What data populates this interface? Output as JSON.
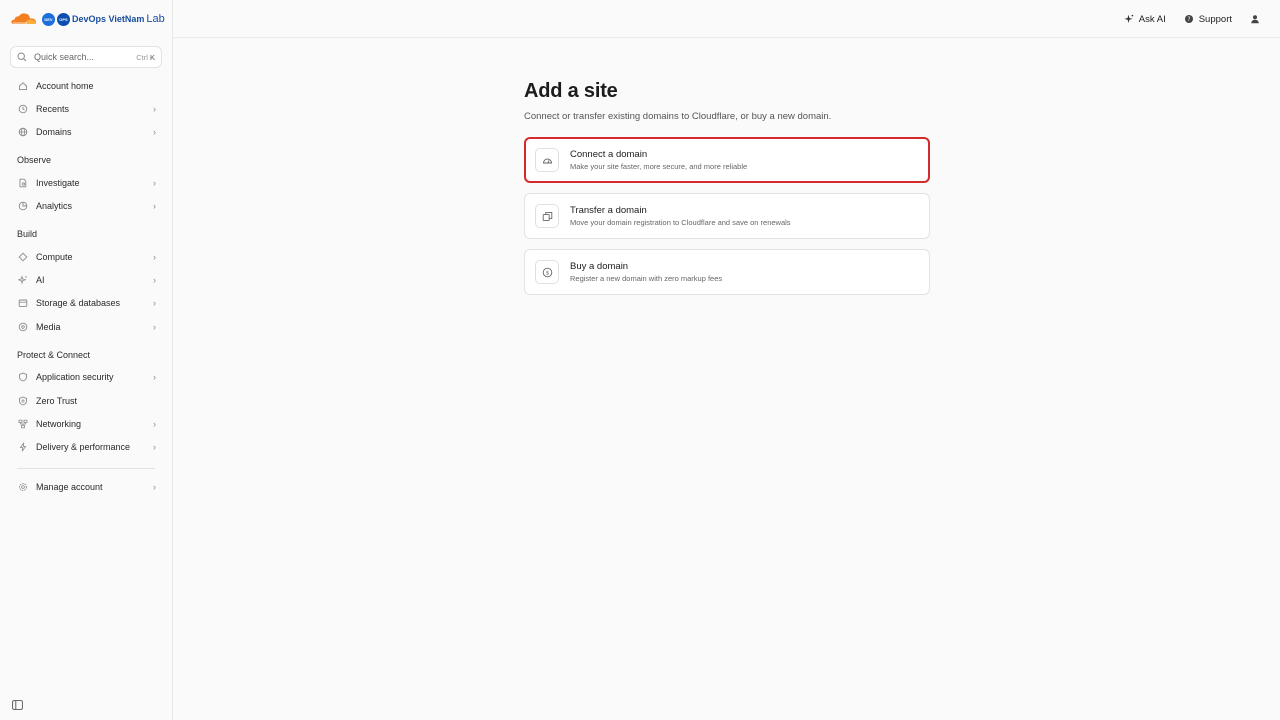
{
  "brand": {
    "badge1": "DEV",
    "badge2": "OPS",
    "name": "DevOps VietNam",
    "suffix": "Lab"
  },
  "search": {
    "placeholder": "Quick search...",
    "shortcut_mod": "Ctrl",
    "shortcut_key": "K"
  },
  "sidebar": {
    "top_items": [
      {
        "label": "Account home",
        "icon": "home-icon"
      },
      {
        "label": "Recents",
        "icon": "clock-icon",
        "chevron": "›"
      },
      {
        "label": "Domains",
        "icon": "globe-icon",
        "chevron": "›"
      }
    ],
    "sections": [
      {
        "label": "Observe",
        "items": [
          {
            "label": "Investigate",
            "icon": "document-search-icon",
            "chevron": "›"
          },
          {
            "label": "Analytics",
            "icon": "pie-chart-icon",
            "chevron": "›"
          }
        ]
      },
      {
        "label": "Build",
        "items": [
          {
            "label": "Compute",
            "icon": "compute-icon",
            "chevron": "›"
          },
          {
            "label": "AI",
            "icon": "sparkle-icon",
            "chevron": "›"
          },
          {
            "label": "Storage & databases",
            "icon": "database-icon",
            "chevron": "›"
          },
          {
            "label": "Media",
            "icon": "media-icon",
            "chevron": "›"
          }
        ]
      },
      {
        "label": "Protect & Connect",
        "items": [
          {
            "label": "Application security",
            "icon": "shield-icon",
            "chevron": "›"
          },
          {
            "label": "Zero Trust",
            "icon": "zero-trust-shield-icon"
          },
          {
            "label": "Networking",
            "icon": "network-icon",
            "chevron": "›"
          },
          {
            "label": "Delivery & performance",
            "icon": "bolt-icon",
            "chevron": "›"
          }
        ]
      }
    ],
    "bottom_items": [
      {
        "label": "Manage account",
        "icon": "gear-icon",
        "chevron": "›"
      }
    ]
  },
  "topbar": {
    "ask_ai": "Ask AI",
    "support": "Support"
  },
  "main": {
    "title": "Add a site",
    "subtitle": "Connect or transfer existing domains to Cloudflare, or buy a new domain.",
    "cards": [
      {
        "title": "Connect a domain",
        "desc": "Make your site faster, more secure, and more reliable",
        "icon": "speedometer-icon",
        "selected": true
      },
      {
        "title": "Transfer a domain",
        "desc": "Move your domain registration to Cloudflare and save on renewals",
        "icon": "transfer-icon",
        "selected": false
      },
      {
        "title": "Buy a domain",
        "desc": "Register a new domain with zero markup fees",
        "icon": "dollar-icon",
        "selected": false
      }
    ]
  },
  "colors": {
    "accent_selected": "#d42a2a",
    "cloudflare_orange": "#f38020",
    "brand_blue": "#1e6fd9"
  }
}
